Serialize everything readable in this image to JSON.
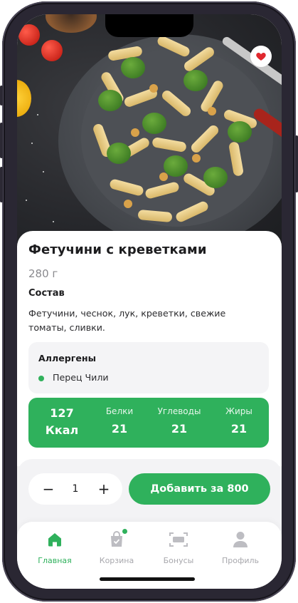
{
  "dish": {
    "title": "Фетучини с креветками",
    "weight": "280 г",
    "composition_title": "Состав",
    "composition": "Фетучини, чеснок, лук, креветки, свежие томаты, сливки."
  },
  "allergens": {
    "title": "Аллергены",
    "items": [
      "Перец Чили"
    ]
  },
  "nutrition": {
    "kcal_value": "127",
    "kcal_unit": "Ккал",
    "proteins_label": "Белки",
    "proteins_value": "21",
    "carbs_label": "Углеводы",
    "carbs_value": "21",
    "fats_label": "Жиры",
    "fats_value": "21"
  },
  "order": {
    "minus": "−",
    "quantity": "1",
    "plus": "+",
    "add_label": "Добавить за 800"
  },
  "tabbar": {
    "home": "Главная",
    "cart": "Корзина",
    "bonus": "Бонусы",
    "profile": "Профиль"
  },
  "icons": {
    "favorite": "heart-icon",
    "home": "home-icon",
    "cart": "shopping-bag-icon",
    "bonus": "scan-card-icon",
    "profile": "user-icon"
  },
  "colors": {
    "accent": "#2fb15c",
    "favorite": "#e0282e"
  }
}
